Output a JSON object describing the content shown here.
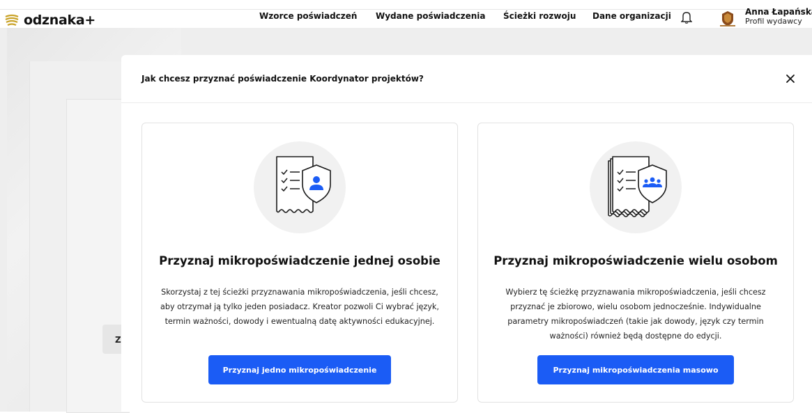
{
  "app": {
    "logo_text": "odznaka+"
  },
  "nav": {
    "items": [
      {
        "label": "Wzorce poświadczeń"
      },
      {
        "label": "Wydane poświadczenia"
      },
      {
        "label": "Ścieżki rozwoju"
      },
      {
        "label": "Dane organizacji"
      }
    ]
  },
  "user": {
    "name": "Anna Łapańska",
    "role": "Profil wydawcy"
  },
  "background": {
    "chip_letter": "Z"
  },
  "modal": {
    "title": "Jak chcesz przyznać poświadczenie Koordynator projektów?",
    "options": [
      {
        "title": "Przyznaj mikropoświadczenie jednej osobie",
        "description": "Skorzystaj z tej ścieżki przyznawania mikropoświadczenia, jeśli chcesz, aby otrzymał ją tylko jeden posiadacz. Kreator pozwoli Ci wybrać język, termin ważności, dowody i ewentualną datę aktywności edukacyjnej.",
        "button": "Przyznaj jedno mikropoświadczenie",
        "icon": "single-certificate-person-icon"
      },
      {
        "title": "Przyznaj mikropoświadczenie wielu osobom",
        "description": "Wybierz tę ścieżkę przyznawania mikropoświadczenia, jeśli chcesz przyznać je zbiorowo, wielu osobom jednocześnie. Indywidualne parametry mikropoświadczeń (takie jak dowody, język czy termin ważności) również będą dostępne do edycji.",
        "button": "Przyznaj mikropoświadczenia masowo",
        "icon": "multiple-certificates-group-icon"
      }
    ]
  },
  "colors": {
    "accent": "#1b5cf5",
    "icon_circle": "#f1f1f1",
    "overlay": "#eeeeee"
  }
}
